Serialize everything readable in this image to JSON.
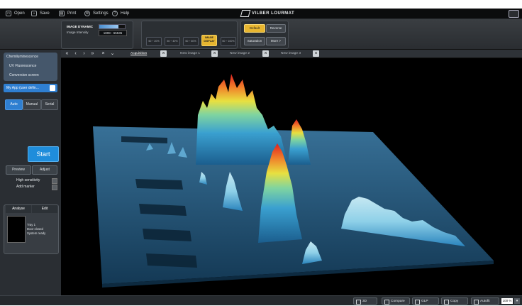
{
  "menubar": {
    "items": [
      {
        "label": "Open",
        "icon": "open-icon"
      },
      {
        "label": "Save",
        "icon": "save-icon"
      },
      {
        "label": "Print",
        "icon": "print-icon"
      },
      {
        "label": "Settings",
        "icon": "settings-icon"
      },
      {
        "label": "Help",
        "icon": "help-icon"
      }
    ],
    "brand": "VILBER LOURMAT"
  },
  "image_dynamic": {
    "title": "IMAGE DYNAMIC",
    "subtitle": "Image Intensity",
    "range_value": "1808 - 65535",
    "fill_fraction": 0.75
  },
  "ranges": [
    {
      "label": "50 ÷ 20%",
      "selected": false
    },
    {
      "label": "50 ÷ 40%",
      "selected": false
    },
    {
      "label": "50 ÷ 60%",
      "selected": false
    },
    {
      "label": "IMAGE DISPLAY",
      "selected": true
    },
    {
      "label": "50 ÷ 100%",
      "selected": false
    }
  ],
  "display_buttons": {
    "default": "Default",
    "saturation": "Saturation",
    "reverse": "Reverse",
    "more": "More >"
  },
  "left_panel": {
    "modes": [
      "Chemiluminescence",
      "UV Fluorescence",
      "Conversion screen"
    ],
    "my_app": "My App (user defin...",
    "tabs": [
      "Auto",
      "Manual",
      "Serial"
    ],
    "start": "Start",
    "preview": "Preview",
    "adjust": "Adjust",
    "high_sensitivity": "High sensitivity",
    "add_marker": "Add marker",
    "status_tabs": [
      "Analyse",
      "Edit"
    ],
    "status_lines": [
      "Tray 1",
      "Door closed",
      "System ready"
    ]
  },
  "image_tabs": [
    "Acquisition",
    "New image 1",
    "New image 2",
    "New image 3"
  ],
  "bottom_buttons": [
    {
      "label": "3D",
      "icon": "cube-icon"
    },
    {
      "label": "Compare",
      "icon": "compare-icon"
    },
    {
      "label": "GLP",
      "icon": "glp-icon"
    },
    {
      "label": "Copy",
      "icon": "copy-icon"
    },
    {
      "label": "Autofit",
      "icon": "autofit-icon"
    }
  ],
  "zoom": "100 %"
}
